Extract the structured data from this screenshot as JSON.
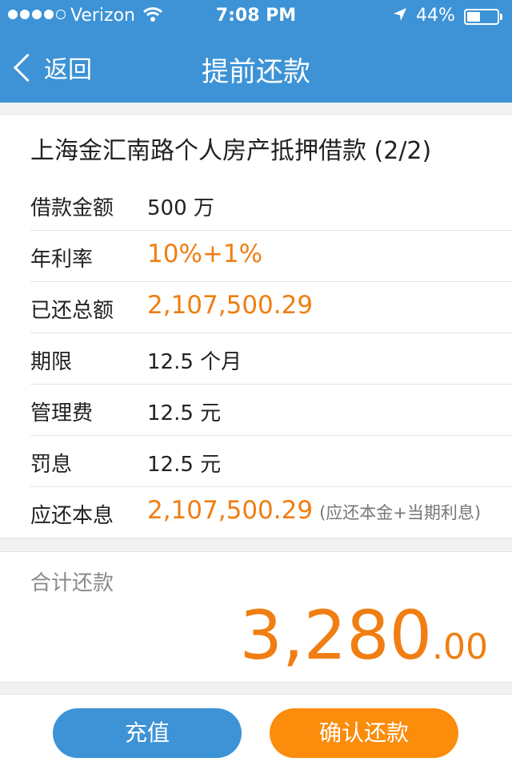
{
  "status_bar": {
    "carrier": "Verizon",
    "time": "7:08 PM",
    "battery": "44%",
    "battery_level": 0.44
  },
  "nav": {
    "back_label": "返回",
    "title": "提前还款"
  },
  "loan": {
    "title": "上海金汇南路个人房产抵押借款 (2/2)",
    "rows": [
      {
        "label": "借款金额",
        "value": "500 万"
      },
      {
        "label": "年利率",
        "value": "10%+1%"
      },
      {
        "label": "已还总额",
        "value": "2,107,500.29"
      },
      {
        "label": "期限",
        "value": "12.5 个月"
      },
      {
        "label": "管理费",
        "value": "12.5 元"
      },
      {
        "label": "罚息",
        "value": "12.5 元"
      },
      {
        "label": "应还本息",
        "value": "2,107,500.29",
        "note": "(应还本金+当期利息)"
      }
    ]
  },
  "total": {
    "label": "合计还款",
    "amount_integer": "3,280",
    "amount_decimal": ".00"
  },
  "buttons": {
    "recharge": "充值",
    "confirm": "确认还款"
  },
  "colors": {
    "brand_blue": "#3d93d6",
    "accent_orange": "#f07e12",
    "button_orange": "#fb8c0c"
  }
}
